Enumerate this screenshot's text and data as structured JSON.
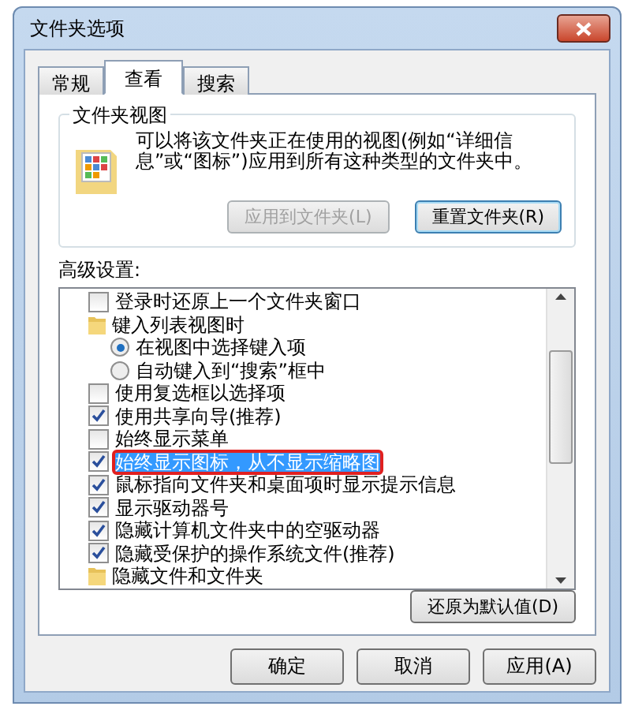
{
  "window": {
    "title": "文件夹选项"
  },
  "tabs": [
    {
      "label": "常规",
      "selected": false
    },
    {
      "label": "查看",
      "selected": true
    },
    {
      "label": "搜索",
      "selected": false
    }
  ],
  "folder_views": {
    "title": "文件夹视图",
    "description": "可以将该文件夹正在使用的视图(例如“详细信息”或“图标”)应用到所有这种类型的文件夹中。",
    "buttons": [
      {
        "label": "应用到文件夹(L)",
        "disabled": true
      },
      {
        "label": "重置文件夹(R)",
        "disabled": false
      }
    ]
  },
  "advanced": {
    "label": "高级设置:",
    "items": [
      {
        "kind": "checkbox",
        "label": "登录时还原上一个文件夹窗口",
        "checked": false,
        "selected": false
      },
      {
        "kind": "folder",
        "label": "键入列表视图时",
        "selected": false
      },
      {
        "kind": "radio",
        "label": "在视图中选择键入项",
        "checked": true,
        "selected": false
      },
      {
        "kind": "radio",
        "label": "自动键入到“搜索”框中",
        "checked": false,
        "selected": false
      },
      {
        "kind": "checkbox",
        "label": "使用复选框以选择项",
        "checked": false,
        "selected": false
      },
      {
        "kind": "checkbox",
        "label": "使用共享向导(推荐)",
        "checked": true,
        "selected": false
      },
      {
        "kind": "checkbox",
        "label": "始终显示菜单",
        "checked": false,
        "selected": false
      },
      {
        "kind": "checkbox",
        "label": "始终显示图标，从不显示缩略图",
        "checked": true,
        "selected": true
      },
      {
        "kind": "checkbox",
        "label": "鼠标指向文件夹和桌面项时显示提示信息",
        "checked": true,
        "selected": false
      },
      {
        "kind": "checkbox",
        "label": "显示驱动器号",
        "checked": true,
        "selected": false
      },
      {
        "kind": "checkbox",
        "label": "隐藏计算机文件夹中的空驱动器",
        "checked": true,
        "selected": false
      },
      {
        "kind": "checkbox",
        "label": "隐藏受保护的操作系统文件(推荐)",
        "checked": true,
        "selected": false
      },
      {
        "kind": "folder",
        "label": "隐藏文件和文件夹",
        "selected": false
      }
    ]
  },
  "restore_button": "还原为默认值(D)",
  "buttons": [
    "确定",
    "取消",
    "应用(A)"
  ]
}
